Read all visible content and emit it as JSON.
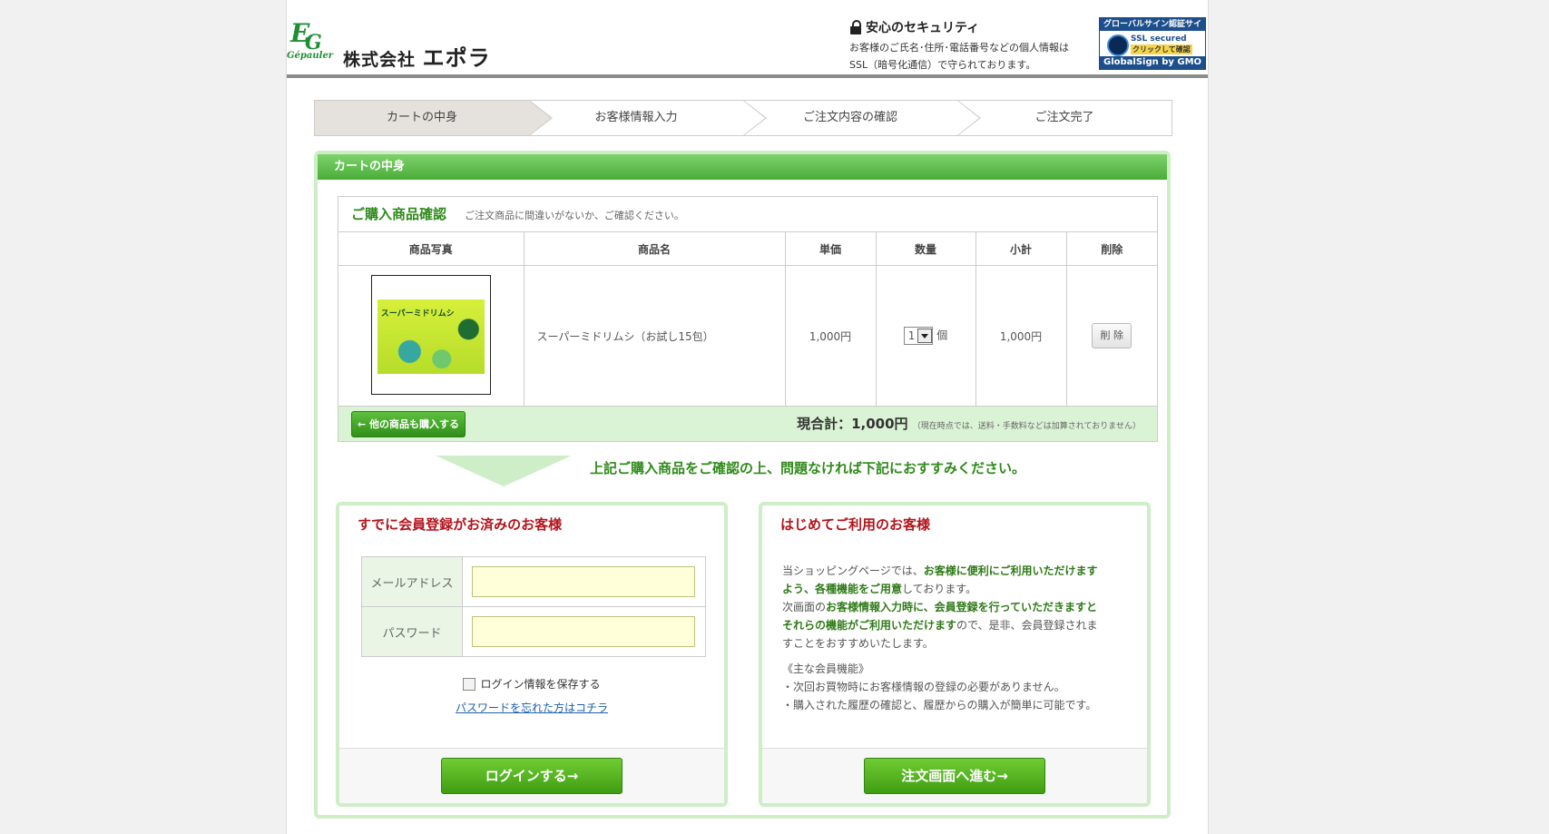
{
  "header": {
    "logo_big": "E",
    "logo_big2": "G",
    "logo_small": "Gépauler",
    "company_prefix": "株式会社",
    "company_name": "エポラ",
    "security_title": "安心のセキュリティ",
    "security_line1": "お客様のご氏名･住所･電話番号などの個人情報は",
    "security_line2": "SSL（暗号化通信）で守られております。",
    "badge_top": "グローバルサイン認証サイト",
    "badge_ssl": "SSL secured",
    "badge_click": "クリックして確認",
    "badge_bottom": "GlobalSign by GMO"
  },
  "steps": [
    {
      "label": "カートの中身"
    },
    {
      "label": "お客様情報入力"
    },
    {
      "label": "ご注文内容の確認"
    },
    {
      "label": "ご注文完了"
    }
  ],
  "cart": {
    "header": "カートの中身",
    "section_title": "ご購入商品確認",
    "section_subtitle": "ご注文商品に間違いがないか、ご確認ください。",
    "columns": [
      "商品写真",
      "商品名",
      "単価",
      "数量",
      "小計",
      "削除"
    ],
    "item": {
      "name": "スーパーミドリムシ（お試し15包）",
      "box_label": "スーパーミドリムシ",
      "price": "1,000円",
      "qty": "1",
      "qty_unit": "個",
      "subtotal": "1,000円",
      "delete_label": "削 除"
    },
    "more_button": "← 他の商品も購入する",
    "total_label": "現合計：1,000円",
    "total_note": "（現在時点では、送料・手数料などは加算されておりません）",
    "instruction": "上記ご購入商品をご確認の上、問題なければ下記におすすみください。"
  },
  "member": {
    "title": "すでに会員登録がお済みのお客様",
    "email_label": "メールアドレス",
    "email_value": "",
    "password_label": "パスワード",
    "password_value": "",
    "save_label": "ログイン情報を保存する",
    "forgot_link": "パスワードを忘れた方はコチラ",
    "login_button": "ログインする→"
  },
  "guest": {
    "title": "はじめてご利用のお客様",
    "p1_a": "当ショッピングページでは、",
    "p1_b": "お客様に便利にご利用いただけます",
    "p1_c": "よう、各種機能をご用意",
    "p1_d": "しております。",
    "p2_a": "次画面の",
    "p2_b": "お客様情報入力時に、会員登録を行っていただきますと",
    "p2_c": "それらの機能がご利用いただけます",
    "p2_d": "ので、是非、会員登録されま",
    "p2_e": "すことをおすすめいたします。",
    "features_title": "《主な会員機能》",
    "feature1": "・次回お買物時にお客様情報の登録の必要がありません。",
    "feature2": "・購入された履歴の確認と、履歴からの購入が簡単に可能です。",
    "order_button": "注文画面へ進む→"
  }
}
